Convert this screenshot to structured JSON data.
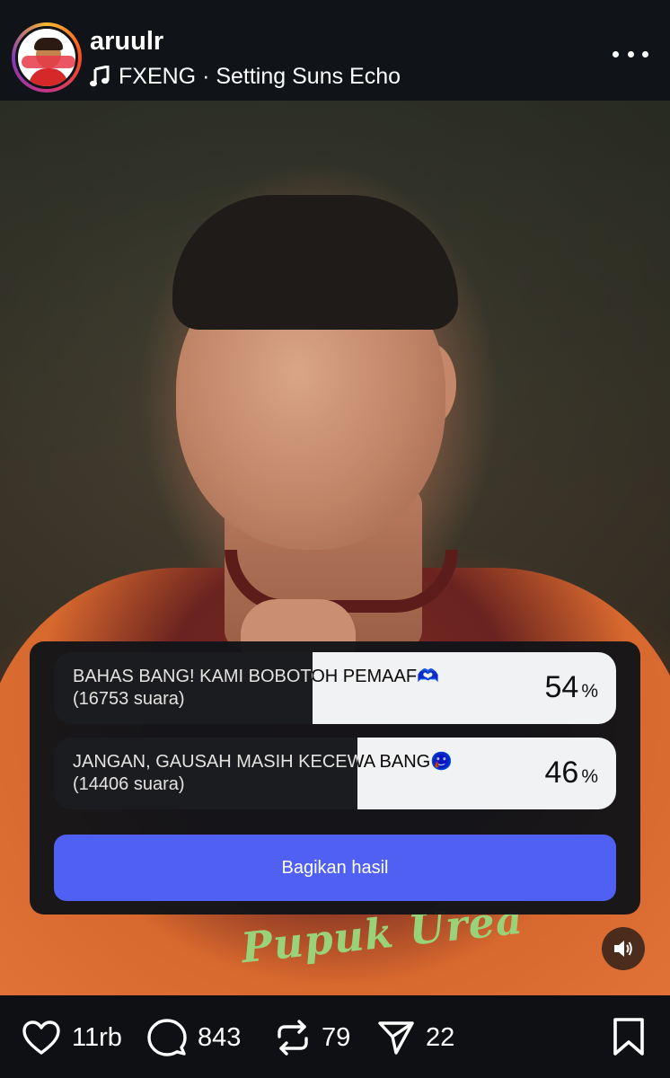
{
  "post": {
    "username": "aruulr",
    "music": "FXENG · Setting Suns Echo"
  },
  "photo": {
    "sponsor_text": "Pupuk Urea"
  },
  "poll": {
    "options": [
      {
        "label": "BAHAS BANG! KAMI BOBOTOH PEMAAF🫶",
        "votes_text": "(16753 suara)",
        "percent": 54,
        "percent_text": "54"
      },
      {
        "label": "JANGAN, GAUSAH MASIH KECEWA BANG🥲",
        "votes_text": "(14406 suara)",
        "percent": 46,
        "percent_text": "46"
      }
    ],
    "percent_sign": "%",
    "share_label": "Bagikan hasil",
    "accent_color": "#4f60f2"
  },
  "actions": {
    "likes": "11rb",
    "comments": "843",
    "reposts": "79",
    "shares": "22"
  },
  "icons": [
    "music-note-icon",
    "more-options-icon",
    "volume-icon",
    "heart-icon",
    "comment-icon",
    "repost-icon",
    "send-icon",
    "bookmark-icon"
  ]
}
